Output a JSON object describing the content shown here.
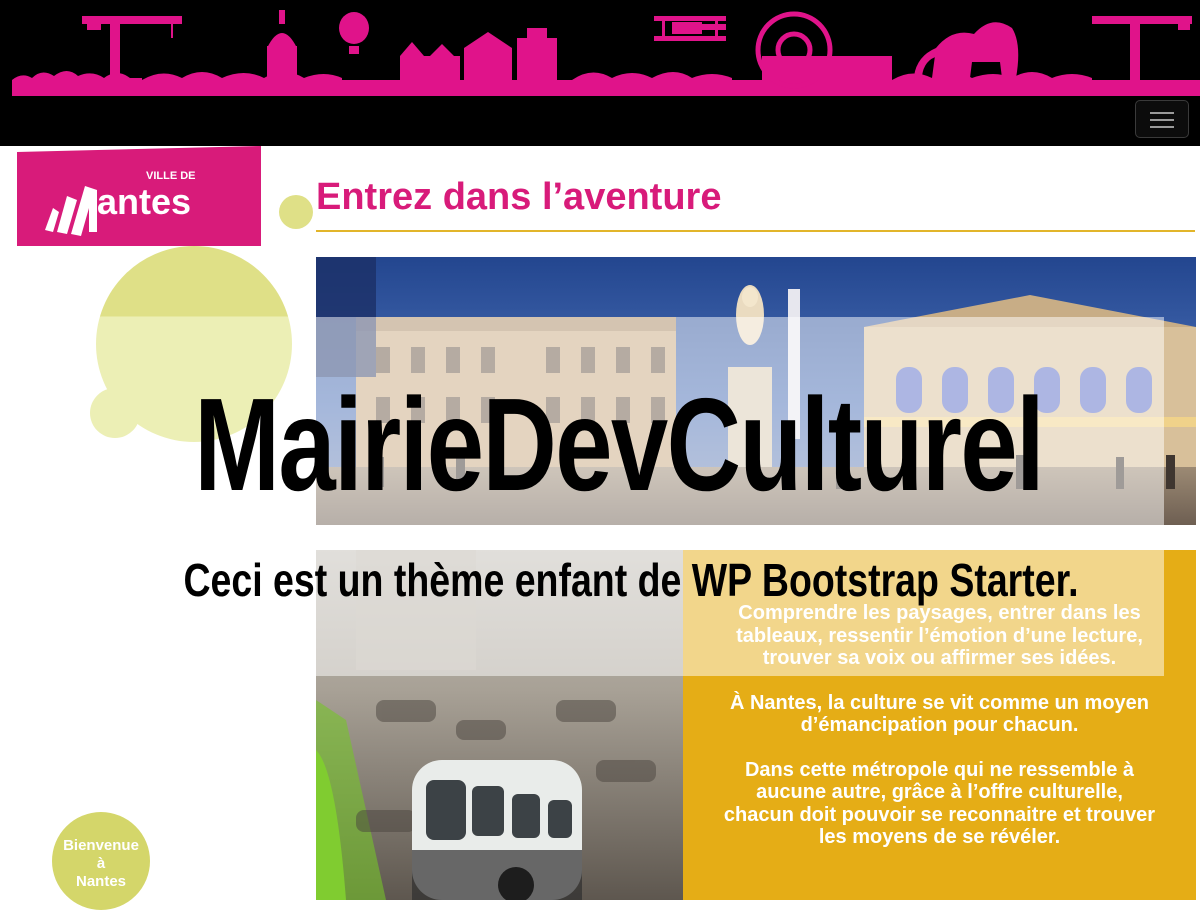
{
  "banner": {
    "background_color": "#000000",
    "skyline_color": "#e0138a",
    "skyline_icons": [
      "crane-icon",
      "dome-icon",
      "balloon-icon",
      "castle-icon",
      "biplane-icon",
      "carousel-icon",
      "elephant-icon",
      "crane-icon"
    ]
  },
  "navbar": {
    "toggle_icon": "hamburger-menu-icon"
  },
  "logo": {
    "prefix": "VILLE DE",
    "name": "antes",
    "background_color": "#d81b7a"
  },
  "page": {
    "heading": "Entrez dans l’aventure",
    "heading_color": "#d81b7a",
    "rule_color": "#e2b52a"
  },
  "site": {
    "title": "MairieDevCulturel",
    "tagline": "Ceci est un thème enfant de WP Bootstrap Starter."
  },
  "culture_panel": {
    "background_color": "#e5ad16",
    "paragraphs": [
      "Comprendre les paysages, entrer dans les tableaux, ressentir l’émotion d’une lecture, trouver sa voix ou affirmer ses idées.",
      "À Nantes, la culture se vit comme un moyen d’émancipation pour chacun.",
      "Dans cette métropole qui ne ressemble à aucune autre, grâce à l’offre culturelle, chacun doit pouvoir se reconnaitre et trouver les moyens de se révéler."
    ]
  },
  "welcome_badge": {
    "line1": "Bienvenue",
    "line2": "à",
    "line3": "Nantes",
    "background_color": "#d4d66a"
  },
  "decor": {
    "blob_light": "#ecefb5",
    "blob_mid": "#dfe087"
  }
}
